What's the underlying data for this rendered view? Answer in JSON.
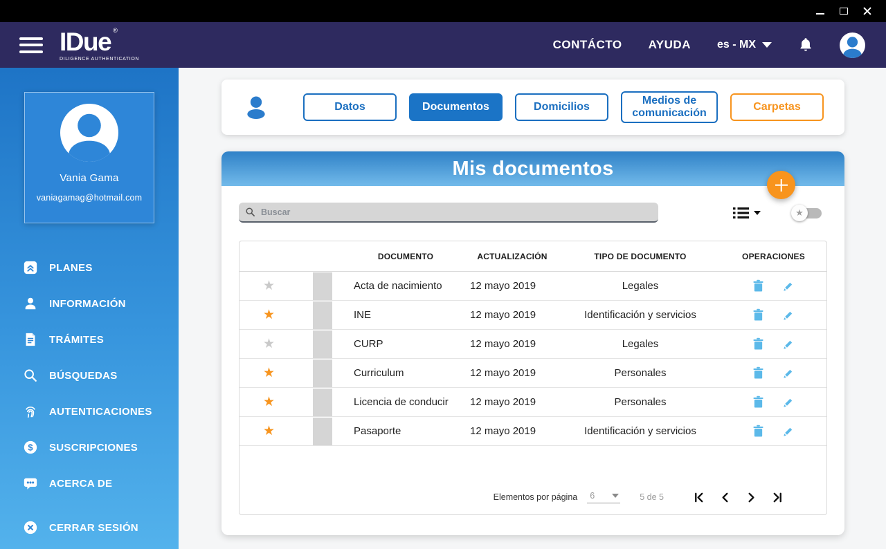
{
  "navbar": {
    "logo_text": "IDue",
    "logo_registered": "®",
    "logo_tagline": "DILIGENCE AUTHENTICATION",
    "contact_label": "CONTÁCTO",
    "help_label": "AYUDA",
    "language_label": "es - MX"
  },
  "sidebar": {
    "profile": {
      "name": "Vania Gama",
      "email": "vaniagamag@hotmail.com"
    },
    "items": [
      {
        "label": "PLANES",
        "icon": "plans-icon"
      },
      {
        "label": "INFORMACIÓN",
        "icon": "person-icon"
      },
      {
        "label": "TRÁMITES",
        "icon": "document-icon"
      },
      {
        "label": "BÚSQUEDAS",
        "icon": "search-icon"
      },
      {
        "label": "AUTENTICACIONES",
        "icon": "fingerprint-icon"
      },
      {
        "label": "SUSCRIPCIONES",
        "icon": "dollar-icon"
      },
      {
        "label": "ACERCA DE",
        "icon": "chat-icon"
      },
      {
        "label": "CERRAR SESIÓN",
        "icon": "logout-icon"
      }
    ]
  },
  "tabs": [
    {
      "label": "Datos",
      "active": false,
      "variant": "blue"
    },
    {
      "label": "Documentos",
      "active": true,
      "variant": "blue"
    },
    {
      "label": "Domicilios",
      "active": false,
      "variant": "blue"
    },
    {
      "label": "Medios de comunicación",
      "active": false,
      "variant": "blue"
    },
    {
      "label": "Carpetas",
      "active": false,
      "variant": "orange"
    }
  ],
  "documents": {
    "title": "Mis documentos",
    "search_placeholder": "Buscar",
    "columns": [
      "DOCUMENTO",
      "ACTUALIZACIÓN",
      "TIPO DE DOCUMENTO",
      "OPERACIONES"
    ],
    "rows": [
      {
        "starred": false,
        "name": "Acta de nacimiento",
        "updated": "12 mayo 2019",
        "type": "Legales"
      },
      {
        "starred": true,
        "name": "INE",
        "updated": "12 mayo 2019",
        "type": "Identificación y servicios"
      },
      {
        "starred": false,
        "name": "CURP",
        "updated": "12 mayo 2019",
        "type": "Legales"
      },
      {
        "starred": true,
        "name": "Curriculum",
        "updated": "12 mayo 2019",
        "type": "Personales"
      },
      {
        "starred": true,
        "name": "Licencia de conducir",
        "updated": "12 mayo 2019",
        "type": "Personales"
      },
      {
        "starred": true,
        "name": "Pasaporte",
        "updated": "12 mayo 2019",
        "type": "Identificación y servicios"
      }
    ],
    "pagination": {
      "items_per_page_label": "Elementos por página",
      "items_per_page_value": "6",
      "range_label": "5 de 5"
    }
  },
  "icons": {
    "star": "★"
  },
  "colors": {
    "titlebar": "#000000",
    "navy": "#2e2a5f",
    "sidebar_top": "#1e74c6",
    "sidebar_bottom": "#53b2ec",
    "primary_blue": "#1b6fc0",
    "header_gradient_top": "#2f81c7",
    "header_gradient_bottom": "#72baea",
    "orange": "#f7941e",
    "operation_icon_blue": "#5cb9e9",
    "star_inactive": "#c9c9c9"
  }
}
